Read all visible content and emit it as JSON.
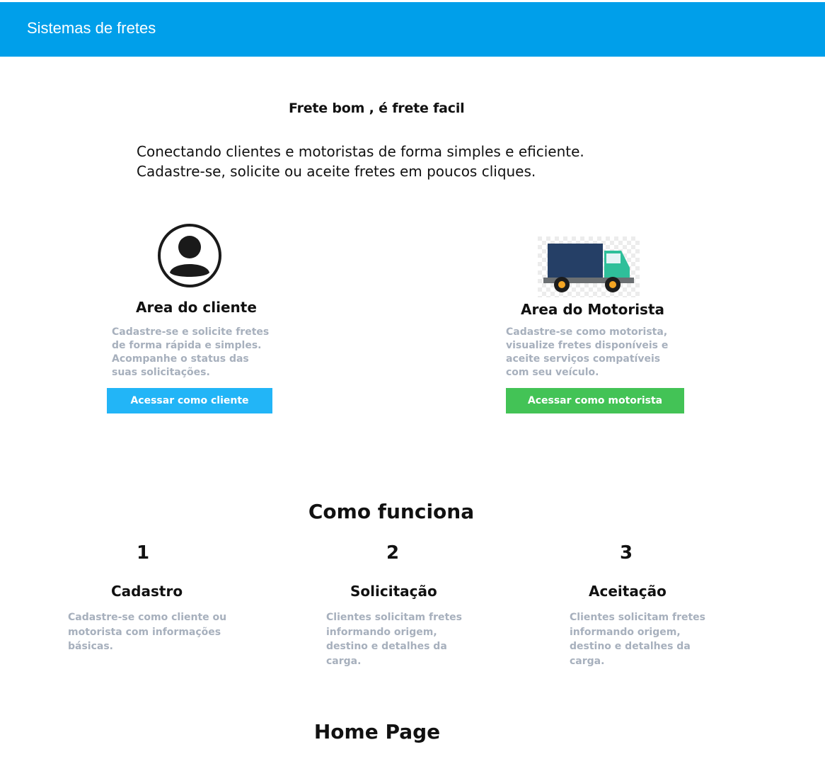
{
  "header": {
    "title": "Sistemas de fretes",
    "color": "#009fea"
  },
  "hero": {
    "tagline": "Frete bom , é frete facil",
    "intro_line1": "Conectando clientes e motoristas de forma simples e eficiente.",
    "intro_line2": "Cadastre-se, solicite ou aceite fretes em poucos cliques."
  },
  "client_card": {
    "icon": "user-avatar-icon",
    "title": "Area do cliente",
    "description": "Cadastre-se e solicite fretes de forma rápida e simples. Acompanhe o status das suas solicitações.",
    "button_label": "Acessar como cliente",
    "button_color": "#22b5f7"
  },
  "driver_card": {
    "icon": "truck-icon",
    "title": "Area do Motorista",
    "description": "Cadastre-se como motorista, visualize fretes disponíveis e aceite serviços compatíveis com seu veículo.",
    "button_label": "Acessar como motorista",
    "button_color": "#43c356"
  },
  "how_it_works": {
    "title": "Como funciona",
    "steps": [
      {
        "number": "1",
        "title": "Cadastro",
        "description": "Cadastre-se como cliente ou motorista com informações básicas."
      },
      {
        "number": "2",
        "title": "Solicitação",
        "description": "Clientes solicitam fretes informando origem, destino e detalhes da carga."
      },
      {
        "number": "3",
        "title": "Aceitação",
        "description": "Clientes solicitam fretes informando origem, destino e detalhes da carga."
      }
    ]
  },
  "footer": {
    "title": "Home Page"
  }
}
